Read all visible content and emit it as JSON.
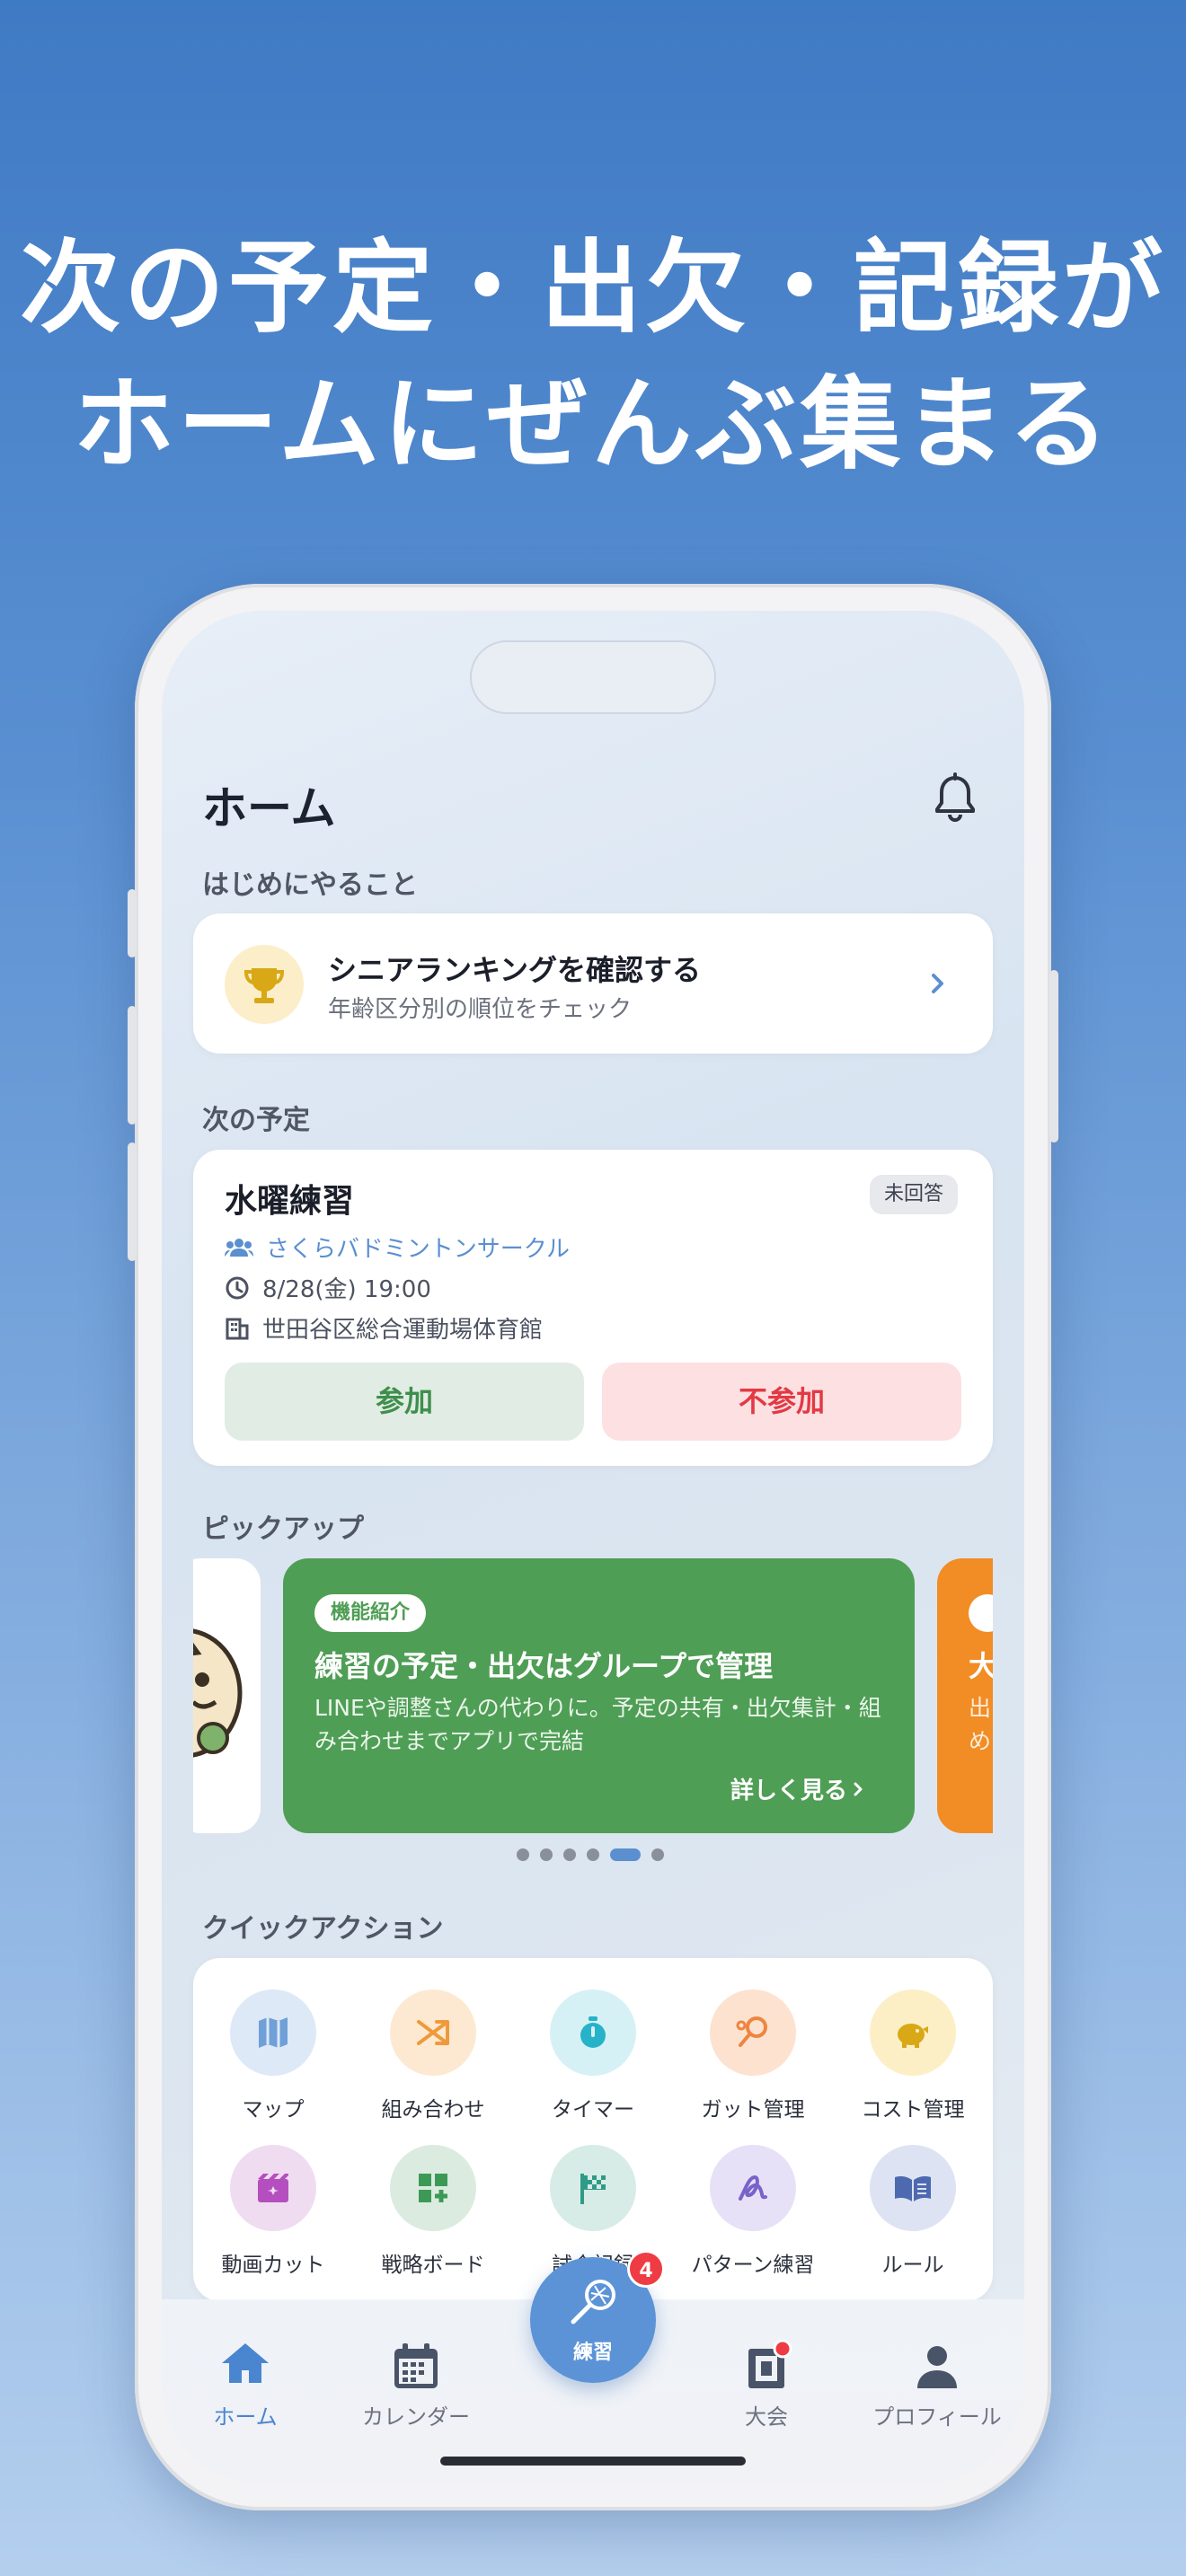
{
  "headline": {
    "line1": "次の予定・出欠・記録が",
    "line2": "ホームにぜんぶ集まる"
  },
  "header": {
    "title": "ホーム"
  },
  "todo": {
    "section_label": "はじめにやること",
    "title": "シニアランキングを確認する",
    "subtitle": "年齢区分別の順位をチェック"
  },
  "schedule": {
    "section_label": "次の予定",
    "event_title": "水曜練習",
    "status_badge": "未回答",
    "group": "さくらバドミントンサークル",
    "datetime": "8/28(金) 19:00",
    "venue": "世田谷区総合運動場体育館",
    "join_label": "参加",
    "decline_label": "不参加"
  },
  "pickup": {
    "section_label": "ピックアップ",
    "main_slide": {
      "tag": "機能紹介",
      "title": "練習の予定・出欠はグループで管理",
      "description": "LINEや調整さんの代わりに。予定の共有・出欠集計・組み合わせまでアプリで完結",
      "more_label": "詳しく見る"
    },
    "next_slide": {
      "title_fragment": "大",
      "desc_fragment_1": "出",
      "desc_fragment_2": "め"
    },
    "dot_count": 6,
    "active_dot": 4
  },
  "quick_actions": {
    "section_label": "クイックアクション",
    "items": [
      {
        "label": "マップ",
        "icon": "map-icon",
        "bg": "#dde9f6",
        "fg": "#6fa0d8"
      },
      {
        "label": "組み合わせ",
        "icon": "shuffle-icon",
        "bg": "#fde9d2",
        "fg": "#ef9a3a"
      },
      {
        "label": "タイマー",
        "icon": "timer-icon",
        "bg": "#d6f1f5",
        "fg": "#26b3c9"
      },
      {
        "label": "ガット管理",
        "icon": "racket-icon",
        "bg": "#fde2d0",
        "fg": "#ee8540"
      },
      {
        "label": "コスト管理",
        "icon": "piggy-bank-icon",
        "bg": "#fcefc6",
        "fg": "#d8a816"
      },
      {
        "label": "動画カット",
        "icon": "video-cut-icon",
        "bg": "#f0dcf1",
        "fg": "#b54fbf"
      },
      {
        "label": "戦略ボード",
        "icon": "strategy-board-icon",
        "bg": "#dcebe0",
        "fg": "#3d9a56"
      },
      {
        "label": "試合記録",
        "icon": "checkered-flag-icon",
        "bg": "#d7ece6",
        "fg": "#2f9b86"
      },
      {
        "label": "パターン練習",
        "icon": "pattern-icon",
        "bg": "#e6e1f6",
        "fg": "#7763c9"
      },
      {
        "label": "ルール",
        "icon": "book-icon",
        "bg": "#dee3f3",
        "fg": "#4d6ab0"
      }
    ]
  },
  "tabbar": {
    "home": "ホーム",
    "calendar": "カレンダー",
    "practice": "練習",
    "practice_badge": "4",
    "tournament": "大会",
    "profile": "プロフィール"
  }
}
